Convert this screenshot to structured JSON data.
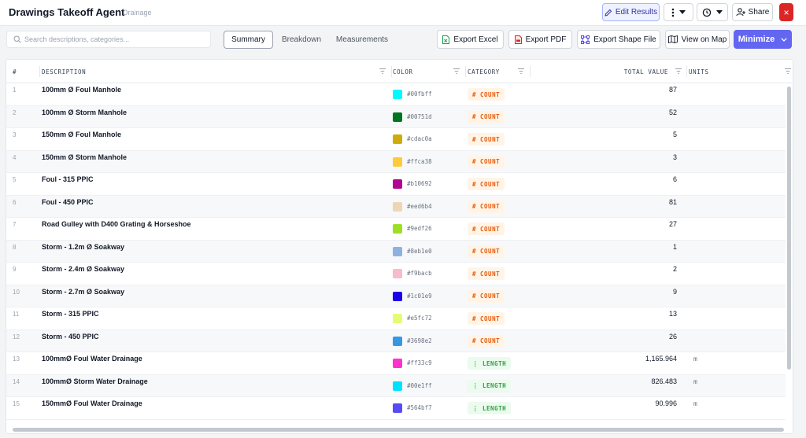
{
  "header": {
    "title": "Drawings Takeoff Agent",
    "subtitle": "Drainage",
    "edit_label": "Edit Results",
    "share_label": "Share",
    "close_label": "×"
  },
  "search": {
    "placeholder": "Search descriptions, categories..."
  },
  "tabs": [
    {
      "label": "Summary",
      "active": true
    },
    {
      "label": "Breakdown",
      "active": false
    },
    {
      "label": "Measurements",
      "active": false
    }
  ],
  "toolbar": {
    "export_excel": "Export Excel",
    "export_pdf": "Export PDF",
    "export_shape": "Export Shape File",
    "view_map": "View on Map",
    "minimize": "Minimize"
  },
  "columns": {
    "num": "#",
    "description": "DESCRIPTION",
    "color": "COLOR",
    "category": "CATEGORY",
    "total": "TOTAL VALUE",
    "units": "UNITS"
  },
  "rows": [
    {
      "num": "1",
      "description": "100mm Ø Foul Manhole",
      "color": "#00fbff",
      "category": "# COUNT",
      "type": "count",
      "total": "87",
      "units": ""
    },
    {
      "num": "2",
      "description": "100mm Ø Storm Manhole",
      "color": "#00751d",
      "category": "# COUNT",
      "type": "count",
      "total": "52",
      "units": ""
    },
    {
      "num": "3",
      "description": "150mm Ø Foul Manhole",
      "color": "#cdac0a",
      "category": "# COUNT",
      "type": "count",
      "total": "5",
      "units": ""
    },
    {
      "num": "4",
      "description": "150mm Ø Storm Manhole",
      "color": "#ffca38",
      "category": "# COUNT",
      "type": "count",
      "total": "3",
      "units": ""
    },
    {
      "num": "5",
      "description": "Foul - 315 PPIC",
      "color": "#b10692",
      "category": "# COUNT",
      "type": "count",
      "total": "6",
      "units": ""
    },
    {
      "num": "6",
      "description": "Foul - 450 PPIC",
      "color": "#eed6b4",
      "category": "# COUNT",
      "type": "count",
      "total": "81",
      "units": ""
    },
    {
      "num": "7",
      "description": "Road Gulley with D400 Grating & Horseshoe",
      "color": "#9edf26",
      "category": "# COUNT",
      "type": "count",
      "total": "27",
      "units": ""
    },
    {
      "num": "8",
      "description": "Storm - 1.2m Ø Soakway",
      "color": "#8eb1e0",
      "category": "# COUNT",
      "type": "count",
      "total": "1",
      "units": ""
    },
    {
      "num": "9",
      "description": "Storm - 2.4m Ø Soakway",
      "color": "#f9bacb",
      "category": "# COUNT",
      "type": "count",
      "total": "2",
      "units": ""
    },
    {
      "num": "10",
      "description": "Storm - 2.7m Ø Soakway",
      "color": "#1c01e9",
      "category": "# COUNT",
      "type": "count",
      "total": "9",
      "units": ""
    },
    {
      "num": "11",
      "description": "Storm - 315 PPIC",
      "color": "#e5fc72",
      "category": "# COUNT",
      "type": "count",
      "total": "13",
      "units": ""
    },
    {
      "num": "12",
      "description": "Storm - 450 PPIC",
      "color": "#3698e2",
      "category": "# COUNT",
      "type": "count",
      "total": "26",
      "units": ""
    },
    {
      "num": "13",
      "description": "100mmØ Foul Water Drainage",
      "color": "#ff33c9",
      "category": "⋮ LENGTH",
      "type": "length",
      "total": "1,165.964",
      "units": "m"
    },
    {
      "num": "14",
      "description": "100mmØ Storm Water Drainage",
      "color": "#00e1ff",
      "category": "⋮ LENGTH",
      "type": "length",
      "total": "826.483",
      "units": "m"
    },
    {
      "num": "15",
      "description": "150mmØ Foul Water Drainage",
      "color": "#564bf7",
      "category": "⋮ LENGTH",
      "type": "length",
      "total": "90.996",
      "units": "m"
    }
  ]
}
